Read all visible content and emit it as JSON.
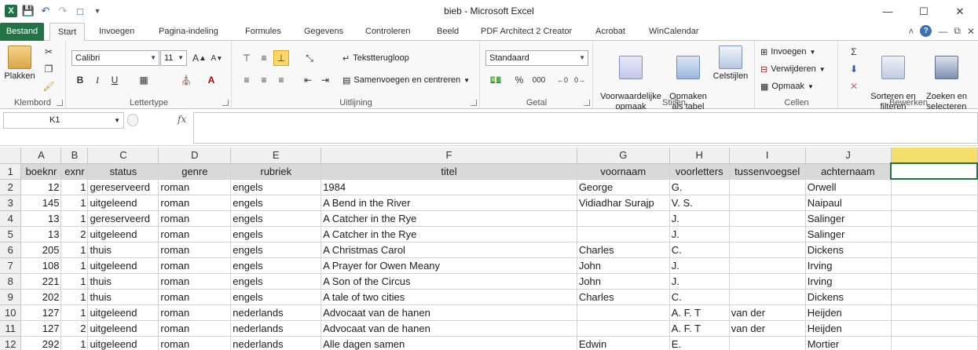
{
  "window": {
    "title": "bieb - Microsoft Excel",
    "app_icon": "X",
    "controls": [
      "minimize-icon",
      "maximize-icon",
      "close-icon"
    ]
  },
  "ribbon_tabs": [
    "Bestand",
    "Start",
    "Invoegen",
    "Pagina-indeling",
    "Formules",
    "Gegevens",
    "Controleren",
    "Beeld",
    "PDF Architect 2 Creator",
    "Acrobat",
    "WinCalendar"
  ],
  "ribbon": {
    "clipboard": {
      "paste": "Plakken",
      "label": "Klembord"
    },
    "font": {
      "name": "Calibri",
      "size": "11",
      "bold": "B",
      "italic": "I",
      "underline": "U",
      "label": "Lettertype"
    },
    "alignment": {
      "wrap": "Tekstterugloop",
      "merge": "Samenvoegen en centreren",
      "label": "Uitlijning"
    },
    "number": {
      "format": "Standaard",
      "percent": "%",
      "thousands": "000",
      "label": "Getal"
    },
    "styles": {
      "conditional": "Voorwaardelijke\nopmaak",
      "table": "Opmaken\nals tabel",
      "cell": "Celstijlen",
      "label": "Stijlen"
    },
    "cells": {
      "insert": "Invoegen",
      "delete": "Verwijderen",
      "format": "Opmaak",
      "label": "Cellen"
    },
    "editing": {
      "sort": "Sorteren en\nfilteren",
      "find": "Zoeken en\nselecteren",
      "label": "Bewerken"
    }
  },
  "formula_bar": {
    "name_box": "K1",
    "fx": "fx",
    "content": ""
  },
  "columns": [
    "A",
    "B",
    "C",
    "D",
    "E",
    "F",
    "G",
    "H",
    "I",
    "J"
  ],
  "header_row": [
    "boeknr",
    "exnr",
    "status",
    "genre",
    "rubriek",
    "titel",
    "voornaam",
    "voorletters",
    "tussenvoegsel",
    "achternaam"
  ],
  "rows": [
    [
      "12",
      "1",
      "gereserveerd",
      "roman",
      "engels",
      "1984",
      "George",
      "G.",
      "",
      "Orwell"
    ],
    [
      "145",
      "1",
      "uitgeleend",
      "roman",
      "engels",
      "A Bend in the River",
      "Vidiadhar Surajp",
      "V. S.",
      "",
      "Naipaul"
    ],
    [
      "13",
      "1",
      "gereserveerd",
      "roman",
      "engels",
      "A Catcher in the Rye",
      "",
      "J.",
      "",
      "Salinger"
    ],
    [
      "13",
      "2",
      "uitgeleend",
      "roman",
      "engels",
      "A Catcher in the Rye",
      "",
      "J.",
      "",
      "Salinger"
    ],
    [
      "205",
      "1",
      "thuis",
      "roman",
      "engels",
      "A Christmas Carol",
      "Charles",
      "C.",
      "",
      "Dickens"
    ],
    [
      "108",
      "1",
      "uitgeleend",
      "roman",
      "engels",
      "A Prayer for Owen Meany",
      "John",
      "J.",
      "",
      "Irving"
    ],
    [
      "221",
      "1",
      "thuis",
      "roman",
      "engels",
      "A Son of the Circus",
      "John",
      "J.",
      "",
      "Irving"
    ],
    [
      "202",
      "1",
      "thuis",
      "roman",
      "engels",
      "A tale of two cities",
      "Charles",
      "C.",
      "",
      "Dickens"
    ],
    [
      "127",
      "1",
      "uitgeleend",
      "roman",
      "nederlands",
      "Advocaat van de hanen",
      "",
      "A. F. T",
      "van der",
      "Heijden"
    ],
    [
      "127",
      "2",
      "uitgeleend",
      "roman",
      "nederlands",
      "Advocaat van de hanen",
      "",
      "A. F. T",
      "van der",
      "Heijden"
    ],
    [
      "292",
      "1",
      "uitgeleend",
      "roman",
      "nederlands",
      "Alle dagen samen",
      "Edwin",
      "E.",
      "",
      "Mortier"
    ]
  ],
  "colors": {
    "excel_green": "#217346",
    "selected_col": "#f3df6a"
  }
}
